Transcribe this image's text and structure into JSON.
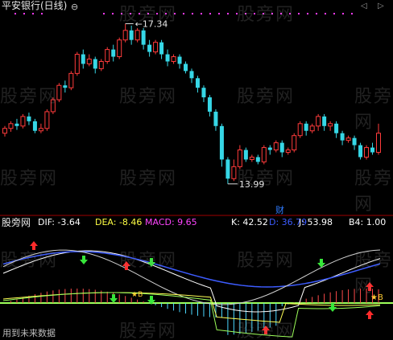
{
  "header": {
    "title": "平安银行(日线)",
    "title_icon": "⊖",
    "scroll_icon": "◁",
    "scroll_icon2": "▷"
  },
  "price_chart": {
    "high_label": "17.34",
    "low_label": "13.99",
    "event_badge": "财",
    "colors": {
      "up": "#ff3b3b",
      "down": "#36d7e6",
      "dots": "#ff3bff"
    }
  },
  "indicator_bar": {
    "name": "股旁网",
    "dif": "DIF: -3.64",
    "dea": "DEA: -8.46",
    "macd": "MACD: 9.65",
    "k": "K: 42.52",
    "d": "D: 36.79",
    "j": "J: 53.98",
    "b4": "B4: 1.00"
  },
  "footer": {
    "future_link": "用到未来数据"
  },
  "watermark": {
    "text": "股旁网"
  },
  "chart_data": {
    "type": "candlestick",
    "high": 17.34,
    "low": 13.99,
    "ylim": [
      13.6,
      17.6
    ],
    "candles": [
      [
        15.05,
        15.15,
        14.98,
        15.2
      ],
      [
        15.15,
        15.25,
        15.08,
        15.3
      ],
      [
        15.25,
        15.2,
        15.12,
        15.35
      ],
      [
        15.2,
        15.4,
        15.15,
        15.45
      ],
      [
        15.4,
        15.3,
        15.22,
        15.48
      ],
      [
        15.3,
        15.1,
        15.05,
        15.35
      ],
      [
        15.1,
        15.15,
        15.05,
        15.25
      ],
      [
        15.15,
        15.5,
        15.1,
        15.55
      ],
      [
        15.5,
        15.75,
        15.45,
        15.8
      ],
      [
        15.75,
        16.05,
        15.7,
        16.1
      ],
      [
        16.05,
        16.0,
        15.9,
        16.15
      ],
      [
        16.0,
        16.3,
        15.95,
        16.35
      ],
      [
        16.3,
        16.7,
        16.25,
        16.75
      ],
      [
        16.7,
        16.5,
        16.4,
        16.8
      ],
      [
        16.5,
        16.6,
        16.45,
        16.7
      ],
      [
        16.6,
        16.4,
        16.3,
        16.65
      ],
      [
        16.4,
        16.55,
        16.35,
        16.6
      ],
      [
        16.55,
        16.8,
        16.5,
        16.85
      ],
      [
        16.8,
        16.65,
        16.55,
        16.9
      ],
      [
        16.65,
        17.0,
        16.6,
        17.05
      ],
      [
        17.0,
        17.2,
        16.95,
        17.34
      ],
      [
        17.2,
        17.0,
        16.9,
        17.3
      ],
      [
        17.0,
        17.2,
        16.95,
        17.25
      ],
      [
        17.2,
        16.9,
        16.8,
        17.25
      ],
      [
        16.9,
        16.75,
        16.65,
        17.0
      ],
      [
        16.75,
        16.95,
        16.7,
        17.0
      ],
      [
        16.95,
        16.7,
        16.6,
        17.0
      ],
      [
        16.7,
        16.55,
        16.45,
        16.8
      ],
      [
        16.55,
        16.65,
        16.5,
        16.7
      ],
      [
        16.65,
        16.5,
        16.4,
        16.7
      ],
      [
        16.5,
        16.35,
        16.3,
        16.55
      ],
      [
        16.35,
        16.2,
        16.1,
        16.4
      ],
      [
        16.2,
        16.0,
        15.9,
        16.25
      ],
      [
        16.0,
        15.8,
        15.7,
        16.05
      ],
      [
        15.8,
        15.5,
        15.4,
        15.85
      ],
      [
        15.5,
        15.2,
        15.1,
        15.55
      ],
      [
        15.2,
        14.5,
        14.35,
        15.25
      ],
      [
        14.5,
        14.1,
        13.99,
        14.55
      ],
      [
        14.1,
        14.35,
        14.05,
        14.5
      ],
      [
        14.35,
        14.7,
        14.3,
        14.8
      ],
      [
        14.7,
        14.5,
        14.45,
        14.75
      ],
      [
        14.5,
        14.55,
        14.45,
        14.6
      ],
      [
        14.55,
        14.45,
        14.4,
        14.6
      ],
      [
        14.45,
        14.75,
        14.4,
        14.8
      ],
      [
        14.75,
        14.7,
        14.6,
        14.8
      ],
      [
        14.7,
        14.85,
        14.65,
        14.9
      ],
      [
        14.85,
        14.65,
        14.55,
        14.9
      ],
      [
        14.65,
        14.7,
        14.6,
        14.75
      ],
      [
        14.7,
        15.0,
        14.65,
        15.05
      ],
      [
        15.0,
        15.25,
        14.95,
        15.3
      ],
      [
        15.25,
        15.1,
        15.0,
        15.3
      ],
      [
        15.1,
        15.2,
        15.05,
        15.25
      ],
      [
        15.2,
        15.4,
        15.1,
        15.45
      ],
      [
        15.4,
        15.2,
        15.1,
        15.45
      ],
      [
        15.2,
        15.25,
        15.1,
        15.3
      ],
      [
        15.25,
        15.05,
        14.95,
        15.3
      ],
      [
        15.05,
        14.9,
        14.8,
        15.1
      ],
      [
        14.9,
        14.95,
        14.85,
        15.0
      ],
      [
        14.95,
        14.8,
        14.7,
        15.0
      ],
      [
        14.8,
        14.55,
        14.5,
        14.85
      ],
      [
        14.55,
        14.75,
        14.5,
        14.8
      ],
      [
        14.75,
        14.65,
        14.6,
        14.85
      ],
      [
        14.65,
        15.05,
        14.6,
        15.25
      ]
    ],
    "indicator": {
      "series": [
        "DIF",
        "DEA",
        "MACD",
        "K",
        "D",
        "J",
        "B4"
      ]
    }
  }
}
